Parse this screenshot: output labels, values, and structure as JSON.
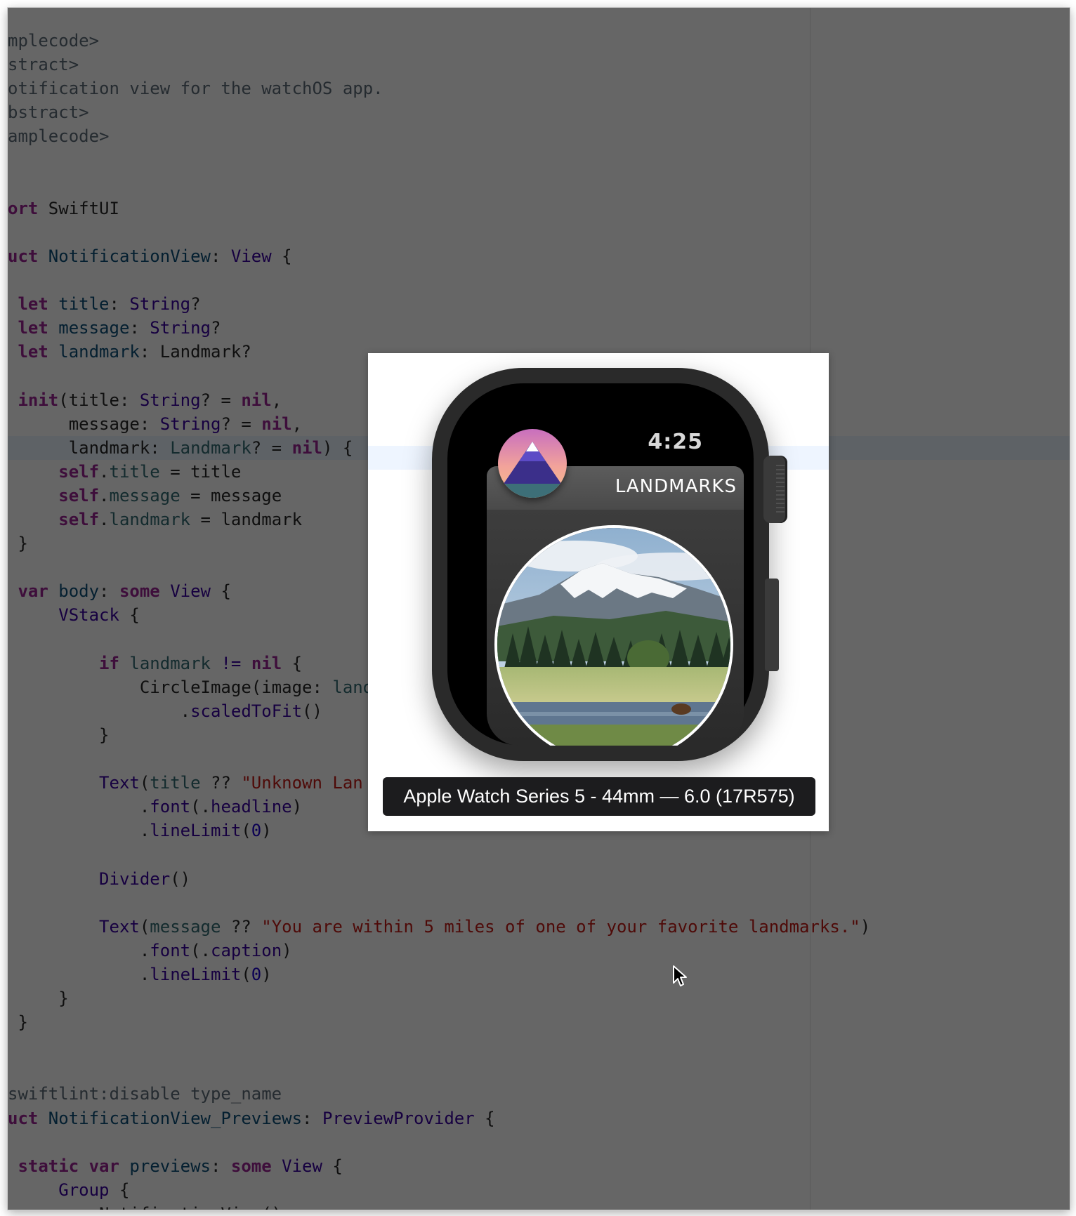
{
  "editor": {
    "lines": [
      [
        {
          "t": "mplecode>",
          "c": "t-com"
        }
      ],
      [
        {
          "t": "stract>",
          "c": "t-com"
        }
      ],
      [
        {
          "t": "otification view for the watchOS app.",
          "c": "t-com"
        }
      ],
      [
        {
          "t": "bstract>",
          "c": "t-com"
        }
      ],
      [
        {
          "t": "amplecode>",
          "c": "t-com"
        }
      ],
      [],
      [],
      [
        {
          "t": "ort",
          "c": "t-kw"
        },
        {
          "t": " SwiftUI",
          "c": "t-pln"
        }
      ],
      [],
      [
        {
          "t": "uct",
          "c": "t-kw"
        },
        {
          "t": " NotificationView",
          "c": "t-typ"
        },
        {
          "t": ": ",
          "c": "t-pln"
        },
        {
          "t": "View",
          "c": "t-sys"
        },
        {
          "t": " {",
          "c": "t-pln"
        }
      ],
      [],
      [
        {
          "t": " let",
          "c": "t-kw"
        },
        {
          "t": " title",
          "c": "t-typ"
        },
        {
          "t": ": ",
          "c": "t-pln"
        },
        {
          "t": "String",
          "c": "t-sys"
        },
        {
          "t": "?",
          "c": "t-pln"
        }
      ],
      [
        {
          "t": " let",
          "c": "t-kw"
        },
        {
          "t": " message",
          "c": "t-typ"
        },
        {
          "t": ": ",
          "c": "t-pln"
        },
        {
          "t": "String",
          "c": "t-sys"
        },
        {
          "t": "?",
          "c": "t-pln"
        }
      ],
      [
        {
          "t": " let",
          "c": "t-kw"
        },
        {
          "t": " landmark",
          "c": "t-typ"
        },
        {
          "t": ": Landmark?",
          "c": "t-pln"
        }
      ],
      [],
      [
        {
          "t": " init",
          "c": "t-kw"
        },
        {
          "t": "(title: ",
          "c": "t-pln"
        },
        {
          "t": "String",
          "c": "t-sys"
        },
        {
          "t": "? = ",
          "c": "t-pln"
        },
        {
          "t": "nil",
          "c": "t-nil"
        },
        {
          "t": ",",
          "c": "t-pln"
        }
      ],
      [
        {
          "t": "      message: ",
          "c": "t-pln"
        },
        {
          "t": "String",
          "c": "t-sys"
        },
        {
          "t": "? = ",
          "c": "t-pln"
        },
        {
          "t": "nil",
          "c": "t-nil"
        },
        {
          "t": ",",
          "c": "t-pln"
        }
      ],
      [
        {
          "t": "      landmark: ",
          "c": "t-pln"
        },
        {
          "t": "Landmark",
          "c": "t-prop"
        },
        {
          "t": "? = ",
          "c": "t-pln"
        },
        {
          "t": "nil",
          "c": "t-nil"
        },
        {
          "t": ") {",
          "c": "t-pln"
        }
      ],
      [
        {
          "t": "     self",
          "c": "t-kw"
        },
        {
          "t": ".",
          "c": "t-pln"
        },
        {
          "t": "title",
          "c": "t-prop"
        },
        {
          "t": " = title",
          "c": "t-pln"
        }
      ],
      [
        {
          "t": "     self",
          "c": "t-kw"
        },
        {
          "t": ".",
          "c": "t-pln"
        },
        {
          "t": "message",
          "c": "t-prop"
        },
        {
          "t": " = message",
          "c": "t-pln"
        }
      ],
      [
        {
          "t": "     self",
          "c": "t-kw"
        },
        {
          "t": ".",
          "c": "t-pln"
        },
        {
          "t": "landmark",
          "c": "t-prop"
        },
        {
          "t": " = landmark",
          "c": "t-pln"
        }
      ],
      [
        {
          "t": " }",
          "c": "t-pln"
        }
      ],
      [],
      [
        {
          "t": " var",
          "c": "t-kw"
        },
        {
          "t": " body",
          "c": "t-typ"
        },
        {
          "t": ": ",
          "c": "t-pln"
        },
        {
          "t": "some",
          "c": "t-kw"
        },
        {
          "t": " View",
          "c": "t-sys"
        },
        {
          "t": " {",
          "c": "t-pln"
        }
      ],
      [
        {
          "t": "     VStack",
          "c": "t-sys"
        },
        {
          "t": " {",
          "c": "t-pln"
        }
      ],
      [],
      [
        {
          "t": "         if",
          "c": "t-kw"
        },
        {
          "t": " landmark ",
          "c": "t-prop"
        },
        {
          "t": "!=",
          "c": "t-sys"
        },
        {
          "t": " ",
          "c": "t-pln"
        },
        {
          "t": "nil",
          "c": "t-nil"
        },
        {
          "t": " {",
          "c": "t-pln"
        }
      ],
      [
        {
          "t": "             CircleImage(image: ",
          "c": "t-pln"
        },
        {
          "t": "landmark",
          "c": "t-prop"
        }
      ],
      [
        {
          "t": "                 .",
          "c": "t-pln"
        },
        {
          "t": "scaledToFit",
          "c": "t-sys"
        },
        {
          "t": "()",
          "c": "t-pln"
        }
      ],
      [
        {
          "t": "         }",
          "c": "t-pln"
        }
      ],
      [],
      [
        {
          "t": "         Text",
          "c": "t-sys"
        },
        {
          "t": "(",
          "c": "t-pln"
        },
        {
          "t": "title",
          "c": "t-prop"
        },
        {
          "t": " ?? ",
          "c": "t-pln"
        },
        {
          "t": "\"Unknown Lan",
          "c": "t-str"
        }
      ],
      [
        {
          "t": "             .",
          "c": "t-pln"
        },
        {
          "t": "font",
          "c": "t-sys"
        },
        {
          "t": "(.",
          "c": "t-pln"
        },
        {
          "t": "headline",
          "c": "t-sys"
        },
        {
          "t": ")",
          "c": "t-pln"
        }
      ],
      [
        {
          "t": "             .",
          "c": "t-pln"
        },
        {
          "t": "lineLimit",
          "c": "t-sys"
        },
        {
          "t": "(",
          "c": "t-pln"
        },
        {
          "t": "0",
          "c": "t-num"
        },
        {
          "t": ")",
          "c": "t-pln"
        }
      ],
      [],
      [
        {
          "t": "         Divider",
          "c": "t-sys"
        },
        {
          "t": "()",
          "c": "t-pln"
        }
      ],
      [],
      [
        {
          "t": "         Text",
          "c": "t-sys"
        },
        {
          "t": "(",
          "c": "t-pln"
        },
        {
          "t": "message",
          "c": "t-prop"
        },
        {
          "t": " ?? ",
          "c": "t-pln"
        },
        {
          "t": "\"You are within 5 miles of one of your favorite landmarks.\"",
          "c": "t-str"
        },
        {
          "t": ")",
          "c": "t-pln"
        }
      ],
      [
        {
          "t": "             .",
          "c": "t-pln"
        },
        {
          "t": "font",
          "c": "t-sys"
        },
        {
          "t": "(.",
          "c": "t-pln"
        },
        {
          "t": "caption",
          "c": "t-sys"
        },
        {
          "t": ")",
          "c": "t-pln"
        }
      ],
      [
        {
          "t": "             .",
          "c": "t-pln"
        },
        {
          "t": "lineLimit",
          "c": "t-sys"
        },
        {
          "t": "(",
          "c": "t-pln"
        },
        {
          "t": "0",
          "c": "t-num"
        },
        {
          "t": ")",
          "c": "t-pln"
        }
      ],
      [
        {
          "t": "     }",
          "c": "t-pln"
        }
      ],
      [
        {
          "t": " }",
          "c": "t-pln"
        }
      ],
      [],
      [],
      [
        {
          "t": "swiftlint:disable type_name",
          "c": "t-com"
        }
      ],
      [
        {
          "t": "uct",
          "c": "t-kw"
        },
        {
          "t": " NotificationView_Previews",
          "c": "t-typ"
        },
        {
          "t": ": ",
          "c": "t-pln"
        },
        {
          "t": "PreviewProvider",
          "c": "t-sys"
        },
        {
          "t": " {",
          "c": "t-pln"
        }
      ],
      [],
      [
        {
          "t": " static",
          "c": "t-kw"
        },
        {
          "t": " var",
          "c": "t-kw"
        },
        {
          "t": " previews",
          "c": "t-typ"
        },
        {
          "t": ": ",
          "c": "t-pln"
        },
        {
          "t": "some",
          "c": "t-kw"
        },
        {
          "t": " View",
          "c": "t-sys"
        },
        {
          "t": " {",
          "c": "t-pln"
        }
      ],
      [
        {
          "t": "     Group",
          "c": "t-sys"
        },
        {
          "t": " {",
          "c": "t-pln"
        }
      ],
      [
        {
          "t": "         NotificationView()",
          "c": "t-pln"
        }
      ]
    ],
    "highlighted_line": 17
  },
  "preview": {
    "watch_time": "4:25",
    "app_title": "LANDMARKS",
    "device_label": "Apple Watch Series 5 - 44mm — 6.0 (17R575)",
    "app_icon": "landmarks-app-icon",
    "photo": "landmark-mountain-photo"
  },
  "icons": {
    "cursor": "mouse-pointer-icon",
    "crown": "digital-crown"
  }
}
